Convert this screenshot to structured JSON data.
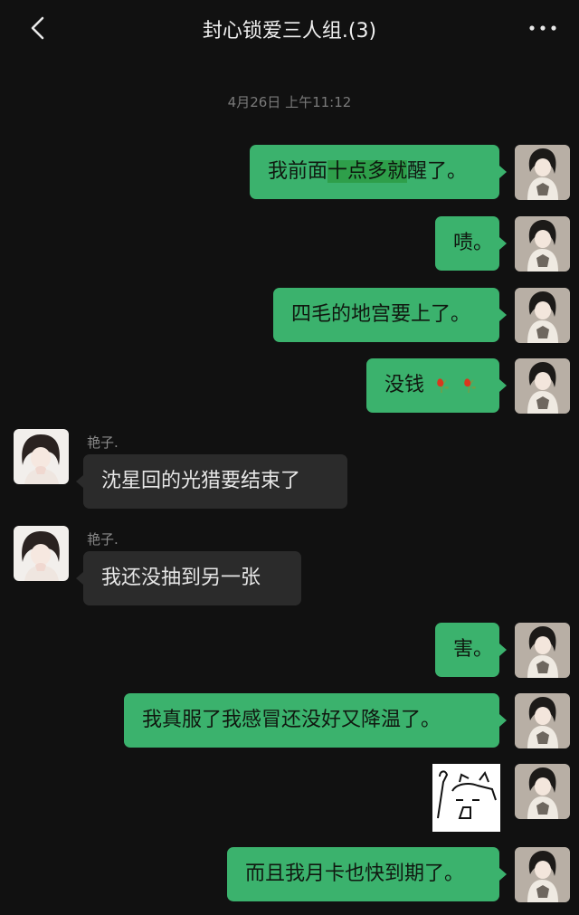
{
  "header": {
    "title": "封心锁爱三人组.(3)",
    "back_icon": "chevron-left-icon",
    "more_icon": "more-dots-icon"
  },
  "timestamp": "4月26日 上午11:12",
  "messages": [
    {
      "side": "me",
      "parts": [
        "我前面",
        "十点多就",
        "醒了。"
      ],
      "highlight_index": 1
    },
    {
      "side": "me",
      "text": "啧。"
    },
    {
      "side": "me",
      "text": "四毛的地宫要上了。"
    },
    {
      "side": "me",
      "text": "没钱",
      "emoji": "wilted-rose-icon",
      "emoji_count": 2
    },
    {
      "side": "them",
      "sender": "艳子.",
      "text": "沈星回的光猎要结束了"
    },
    {
      "side": "them",
      "sender": "艳子.",
      "text": "我还没抽到另一张"
    },
    {
      "side": "me",
      "text": "害。"
    },
    {
      "side": "me",
      "text": "我真服了我感冒还没好又降温了。"
    },
    {
      "side": "me",
      "sticker": "cat-doodle-sticker"
    },
    {
      "side": "me",
      "text": "而且我月卡也快到期了。"
    }
  ],
  "colors": {
    "background": "#111111",
    "my_bubble": "#3bb26d",
    "their_bubble": "#2b2b2b",
    "highlight": "#2e9f4a"
  }
}
